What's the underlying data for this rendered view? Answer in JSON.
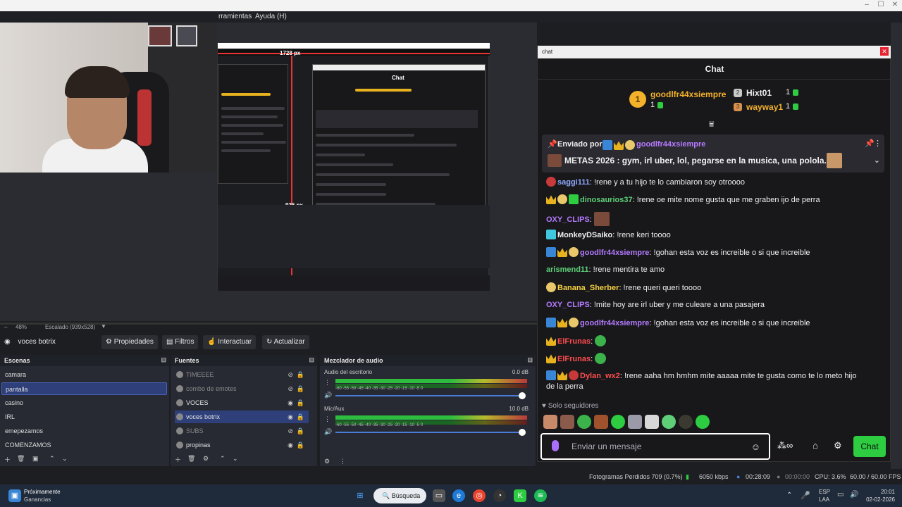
{
  "menubar": {
    "item_tools": "rramientas",
    "item_help": "Ayuda (H)"
  },
  "preview": {
    "nested_width_label": "1728 px",
    "nested_height_label": "936 px",
    "nested_chat_title": "Chat"
  },
  "scalebar": {
    "zoom": "48%",
    "scale": "Escalado (939x528)"
  },
  "source_toolbar": {
    "selected_source": "voces botrix",
    "properties": "Propiedades",
    "filters": "Filtros",
    "interact": "Interactuar",
    "refresh": "Actualizar"
  },
  "scenes": {
    "title": "Escenas",
    "items": [
      "camara",
      "pantalla",
      "casino",
      "IRL",
      "emepezamos",
      "COMENZAMOS"
    ],
    "selected_index": 1
  },
  "sources": {
    "title": "Fuentes",
    "items": [
      {
        "name": "TIMEEEE",
        "visible": false
      },
      {
        "name": "combo de emotes",
        "visible": false
      },
      {
        "name": "VOCES",
        "visible": true
      },
      {
        "name": "voces botrix",
        "visible": true
      },
      {
        "name": "SUBS",
        "visible": false
      },
      {
        "name": "propinas",
        "visible": true
      }
    ]
  },
  "mixer": {
    "title": "Mezclador de audio",
    "tracks": [
      {
        "name": "Audio del escritorio",
        "db": "0.0 dB",
        "level": 0.72
      },
      {
        "name": "Mic/Aux",
        "db": "10.0 dB",
        "level": 0.72
      }
    ],
    "ticks": "-60  -55  -50  -45  -40  -35  -30  -25  -20  -15  -10  -5  0"
  },
  "status": {
    "dropped": "Fotogramas Perdidos 709 (0.7%)",
    "bitrate": "6050 kbps",
    "live": "00:28:09",
    "rec": "00:00:00",
    "cpu": "CPU: 3.6%",
    "fps": "60.00 / 60.00 FPS"
  },
  "taskbar": {
    "notif_title": "Próximamente",
    "notif_sub": "Ganancias",
    "search": "Búsqueda",
    "lang": "ESP",
    "lang2": "LAA",
    "time": "20:01",
    "date": "02-02-2026"
  },
  "chat": {
    "window_title": "chat",
    "header": "Chat",
    "top_gifters": [
      {
        "rank": "1",
        "name": "goodlfr44xsiempre",
        "count": "1",
        "color": "#f4b12a"
      },
      {
        "name": "Hixt01",
        "count": "1"
      },
      {
        "name": "wayway1",
        "count": "1"
      }
    ],
    "pinned": {
      "label": "Enviado por",
      "user": "goodlfr44xsiempre",
      "text": "METAS 2026 : gym, irl uber, lol, pegarse en la musica, una polola."
    },
    "messages": [
      {
        "user": "saggi111",
        "color": "#8fa8ff",
        "text": ": !rene y a tu hijo te lo cambiaron soy otroooo"
      },
      {
        "user": "dinosaurios37",
        "color": "#5ecf78",
        "text": ": !rene oe mite nome gusta que me graben ijo de perra"
      },
      {
        "user": "OXY_CLIPS",
        "color": "#b57aff",
        "text": ":"
      },
      {
        "user": "MonkeyDSaiko",
        "color": "#efeff1",
        "text": ": !rene keri toooo"
      },
      {
        "user": "goodlfr44xsiempre",
        "color": "#b57aff",
        "text": ": !gohan esta voz es increible o si que increible"
      },
      {
        "user": "arismend11",
        "color": "#5ecf78",
        "text": ": !rene mentira te amo"
      },
      {
        "user": "Banana_Sherber",
        "color": "#f4d03f",
        "text": ": !rene queri queri toooo"
      },
      {
        "user": "OXY_CLIPS",
        "color": "#b57aff",
        "text": ": !mite hoy are irl uber y me culeare a una pasajera"
      },
      {
        "user": "goodlfr44xsiempre",
        "color": "#b57aff",
        "text": ": !gohan esta voz es increible o si que increible"
      },
      {
        "user": "ElFrunas",
        "color": "#ff4d4d",
        "text": ":"
      },
      {
        "user": "ElFrunas",
        "color": "#ff4d4d",
        "text": ":"
      },
      {
        "user": "Dylan_wx2",
        "color": "#ff4d4d",
        "text": ": !rene aaha hm hmhm mite aaaaa mite te gusta como te lo meto hijo"
      },
      {
        "user": "",
        "color": "#efeff1",
        "text": "de la perra"
      }
    ],
    "followers_only": "Solo seguidores",
    "input_placeholder": "Enviar un mensaje",
    "send": "Chat"
  }
}
